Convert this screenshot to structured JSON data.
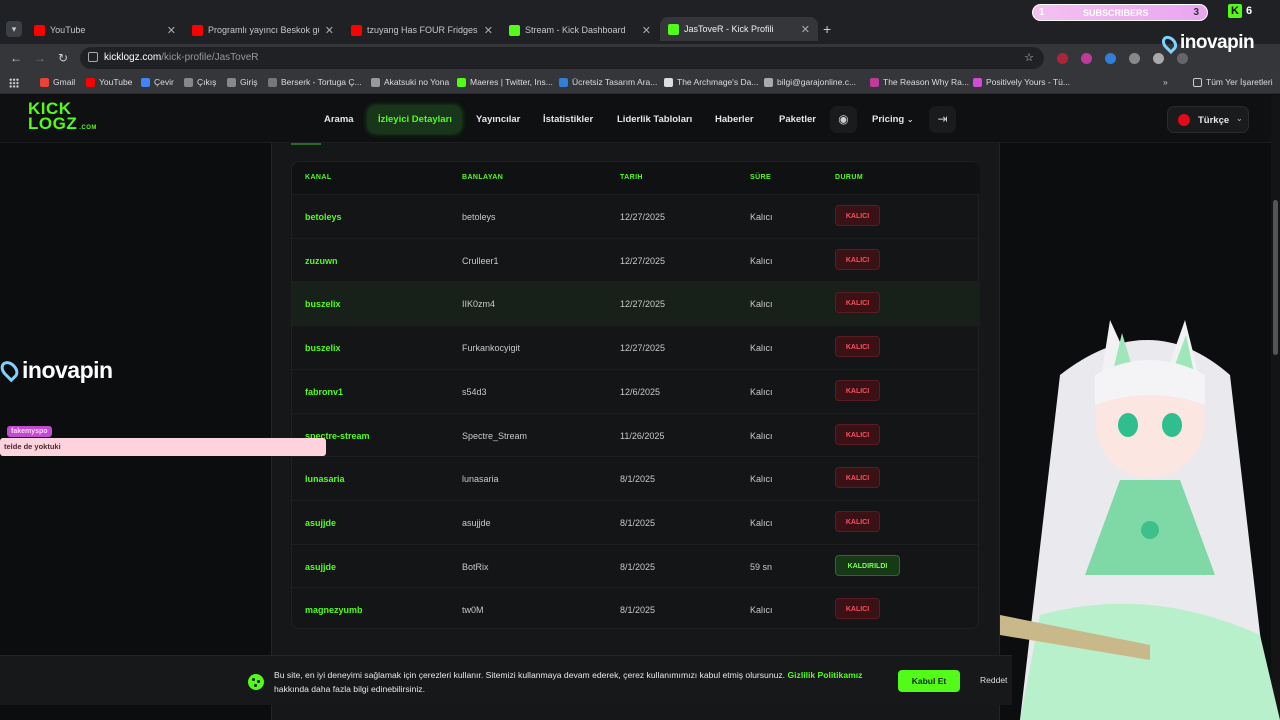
{
  "browser": {
    "tabs": [
      {
        "title": "YouTube",
        "color": "#ff0000",
        "active": false
      },
      {
        "title": "Programlı yayıncı Beskok gülm...",
        "color": "#ff0000",
        "active": false
      },
      {
        "title": "tzuyang Has FOUR Fridges?! W...",
        "color": "#ff0000",
        "active": false
      },
      {
        "title": "Stream - Kick Dashboard",
        "color": "#53fc18",
        "active": false
      },
      {
        "title": "JasToveR - Kick Profili",
        "color": "#53fc18",
        "active": true
      }
    ],
    "url_host": "kicklogz.com",
    "url_path": "/kick-profile/JasToveR",
    "bookmarks": [
      "Gmail",
      "YouTube",
      "Çevir",
      "Çıkış",
      "Giriş",
      "Berserk - Tortuga Ç...",
      "Akatsuki no Yona",
      "Maeres | Twitter, Ins...",
      "Ücretsiz Tasarım Ara...",
      "The Archmage's Da...",
      "bilgi@garajonline.c...",
      "The Reason Why Ra...",
      "Positively Yours - Tü..."
    ],
    "all_bookmarks": "Tüm Yer İşaretleri"
  },
  "site": {
    "logo_line1": "KICK",
    "logo_line2": "LOGZ",
    "logo_suffix": ".COM",
    "nav": [
      "Arama",
      "İzleyici Detayları",
      "Yayıncılar",
      "İstatistikler",
      "Liderlik Tabloları",
      "Haberler",
      "Paketler",
      "Pricing"
    ],
    "language": "Türkçe",
    "accent": "#53fc18"
  },
  "table": {
    "headers": [
      "KANAL",
      "BANLAYAN",
      "TARIH",
      "SÜRE",
      "DURUM"
    ],
    "rows": [
      {
        "kanal": "betoleys",
        "banlayan": "betoleys",
        "tarih": "12/27/2025",
        "sure": "Kalıcı",
        "durum": "KALICI",
        "status": "red"
      },
      {
        "kanal": "zuzuwn",
        "banlayan": "Crulleer1",
        "tarih": "12/27/2025",
        "sure": "Kalıcı",
        "durum": "KALICI",
        "status": "red"
      },
      {
        "kanal": "buszelix",
        "banlayan": "IIK0zm4",
        "tarih": "12/27/2025",
        "sure": "Kalıcı",
        "durum": "KALICI",
        "status": "red"
      },
      {
        "kanal": "buszelix",
        "banlayan": "Furkankocyigit",
        "tarih": "12/27/2025",
        "sure": "Kalıcı",
        "durum": "KALICI",
        "status": "red"
      },
      {
        "kanal": "fabronv1",
        "banlayan": "s54d3",
        "tarih": "12/6/2025",
        "sure": "Kalıcı",
        "durum": "KALICI",
        "status": "red"
      },
      {
        "kanal": "spectre-stream",
        "banlayan": "Spectre_Stream",
        "tarih": "11/26/2025",
        "sure": "Kalıcı",
        "durum": "KALICI",
        "status": "red"
      },
      {
        "kanal": "lunasaria",
        "banlayan": "lunasaria",
        "tarih": "8/1/2025",
        "sure": "Kalıcı",
        "durum": "KALICI",
        "status": "red"
      },
      {
        "kanal": "asujjde",
        "banlayan": "asujjde",
        "tarih": "8/1/2025",
        "sure": "Kalıcı",
        "durum": "KALICI",
        "status": "red"
      },
      {
        "kanal": "asujjde",
        "banlayan": "BotRix",
        "tarih": "8/1/2025",
        "sure": "59 sn",
        "durum": "KALDIRILDI",
        "status": "green"
      },
      {
        "kanal": "magnezyumb",
        "banlayan": "tw0M",
        "tarih": "8/1/2025",
        "sure": "Kalıcı",
        "durum": "KALICI",
        "status": "red"
      }
    ]
  },
  "overlay": {
    "watermark": "inovapin",
    "subs_label": "SUBSCRIBERS",
    "subs_current": "1",
    "subs_goal": "3",
    "kick_letter": "K",
    "kick_count": "6",
    "chat_user": "fakemyspo",
    "chat_message": "telde de yoktuki"
  },
  "cookie": {
    "text": "Bu site, en iyi deneyimi sağlamak için çerezleri kullanır. Sitemizi kullanmaya devam ederek, çerez kullanımımızı kabul etmiş olursunuz.",
    "link": "Gizlilik Politikamız",
    "text_after": "hakkında daha fazla bilgi edinebilirsiniz.",
    "accept": "Kabul Et",
    "reject": "Reddet"
  }
}
